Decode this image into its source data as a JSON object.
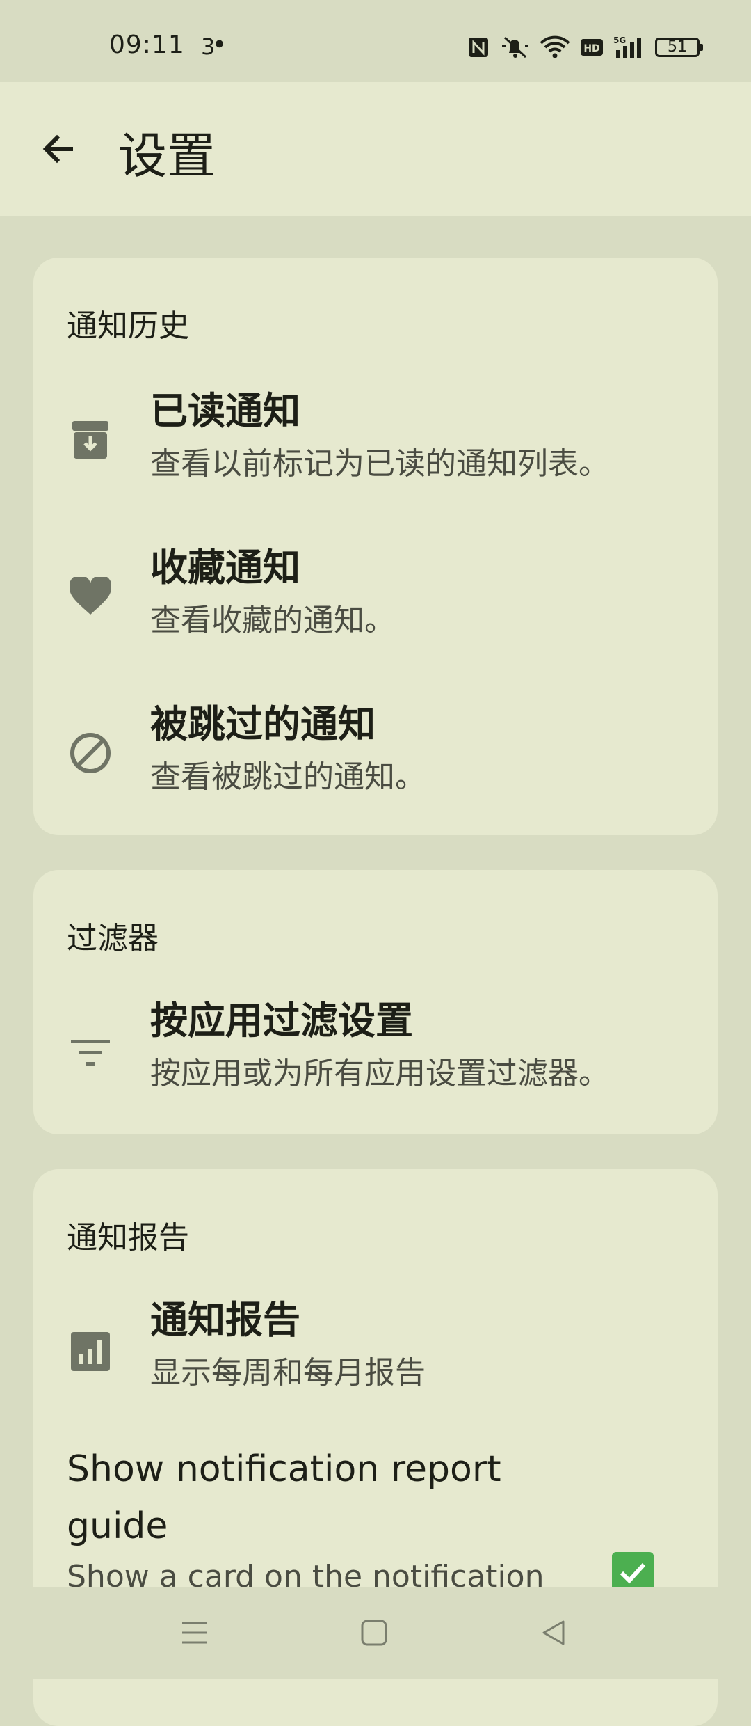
{
  "status_bar": {
    "time": "09:11",
    "extra": "3",
    "battery_level": "51",
    "icons": [
      "nfc-icon",
      "mute-icon",
      "wifi-icon",
      "hd-icon",
      "signal-5g-icon",
      "battery-icon"
    ]
  },
  "app_bar": {
    "title": "设置",
    "back_icon": "arrow-back-icon"
  },
  "sections": [
    {
      "title": "通知历史",
      "items": [
        {
          "icon": "archive-download-icon",
          "title": "已读通知",
          "subtitle": "查看以前标记为已读的通知列表。"
        },
        {
          "icon": "heart-icon",
          "title": "收藏通知",
          "subtitle": "查看收藏的通知。"
        },
        {
          "icon": "block-icon",
          "title": "被跳过的通知",
          "subtitle": "查看被跳过的通知。"
        }
      ]
    },
    {
      "title": "过滤器",
      "items": [
        {
          "icon": "filter-list-icon",
          "title": "按应用过滤设置",
          "subtitle": "按应用或为所有应用设置过滤器。"
        }
      ]
    },
    {
      "title": "通知报告",
      "items": [
        {
          "icon": "bar-chart-icon",
          "title": "通知报告",
          "subtitle": "显示每周和每月报告"
        }
      ],
      "toggle": {
        "title": "Show notification report guide",
        "subtitle": "Show a card on the notification",
        "checked": true
      }
    }
  ],
  "nav_bar": {
    "buttons": [
      "menu-icon",
      "home-icon",
      "back-triangle-icon"
    ]
  },
  "colors": {
    "background": "#d8dcc2",
    "card": "#e6e9cf",
    "icon": "#6f7465",
    "checkbox": "#4caf50"
  }
}
